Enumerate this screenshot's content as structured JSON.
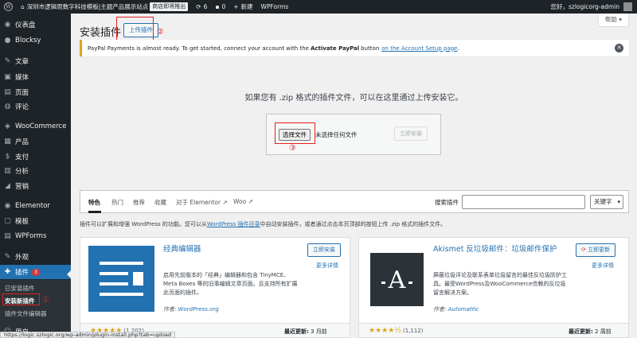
{
  "admin_bar": {
    "site_name": "深圳市逻辑思数字科技模板|主题产品展示站点",
    "badge": "商店即将推出",
    "updates": "6",
    "comments": "0",
    "new": "新建",
    "wpforms": "WPForms",
    "greeting": "您好，szlogicorg-admin"
  },
  "sidebar": {
    "items": [
      {
        "label": "仪表盘",
        "icon": "dashboard-icon",
        "glyph": "◉"
      },
      {
        "label": "Blocksy",
        "icon": "blocksy-icon",
        "glyph": "●"
      },
      {
        "label": "文章",
        "icon": "pin-icon",
        "glyph": "✎"
      },
      {
        "label": "媒体",
        "icon": "media-icon",
        "glyph": "▣"
      },
      {
        "label": "页面",
        "icon": "page-icon",
        "glyph": "▤"
      },
      {
        "label": "评论",
        "icon": "comment-icon",
        "glyph": "◍"
      },
      {
        "label": "WooCommerce",
        "icon": "woocommerce-icon",
        "glyph": "◈"
      },
      {
        "label": "产品",
        "icon": "product-icon",
        "glyph": "▦"
      },
      {
        "label": "支付",
        "icon": "payment-icon",
        "glyph": "$"
      },
      {
        "label": "分析",
        "icon": "analytics-icon",
        "glyph": "▥"
      },
      {
        "label": "营销",
        "icon": "marketing-icon",
        "glyph": "◢"
      },
      {
        "label": "Elementor",
        "icon": "elementor-icon",
        "glyph": "◉"
      },
      {
        "label": "模板",
        "icon": "template-icon",
        "glyph": "▢"
      },
      {
        "label": "WPForms",
        "icon": "wpforms-icon",
        "glyph": "▤"
      },
      {
        "label": "外观",
        "icon": "appearance-icon",
        "glyph": "✎"
      },
      {
        "label": "插件",
        "icon": "plugin-icon",
        "glyph": "✚",
        "badge": "3"
      }
    ],
    "submenu": [
      "已安装插件",
      "安装新插件",
      "插件文件编辑器"
    ],
    "users": "用户"
  },
  "header": {
    "title": "安装插件",
    "upload_button": "上传插件",
    "help": "帮助 ▾"
  },
  "annotations": [
    "②",
    "①",
    "③"
  ],
  "notice": {
    "text_before": "PayPal Payments is almost ready. To get started, connect your account with the",
    "bold": "Activate PayPal",
    "text_mid": "button",
    "link": "on the Account Setup page",
    "text_after": "."
  },
  "upload": {
    "description": "如果您有 .zip 格式的插件文件，可以在这里通过上传安装它。",
    "choose_button": "选择文件",
    "no_file": "未选择任何文件",
    "install_button": "立即安装"
  },
  "filters": {
    "tabs": [
      "特色",
      "热门",
      "推荐",
      "收藏",
      "对于 Elementor ↗",
      "Woo ↗"
    ],
    "search_label": "搜索插件",
    "search_placeholder": "",
    "select_value": "关键字"
  },
  "intro": {
    "before": "插件可以扩展和增强 WordPress 的功能。您可以从",
    "link": "WordPress 插件目录",
    "after": "中自动安装插件，或者通过点击本页顶部的按钮上传 .zip 格式的插件文件。"
  },
  "plugins": [
    {
      "name": "经典编辑器",
      "description": "启用先前版本的「经典」编辑器和包含 TinyMCE、Meta Boxes 等的旧事编辑文章页面。且支持所有扩展此页面的插件。",
      "author_label": "作者:",
      "author": "WordPress.org",
      "button": "立即安装",
      "more": "更多详情",
      "rating": 5,
      "stars": "★★★★★",
      "rating_count": "(1,202)",
      "updated_label": "最近更新:",
      "updated_value": "3 月前"
    },
    {
      "name": "Akismet 反垃圾邮件：垃圾邮件保护",
      "description": "屏蔽垃圾评论及联系表单垃圾留言的最佳反垃圾防护工具。最受WordPress及WooCommerce信赖的反垃圾留言解决方案。",
      "author_label": "作者:",
      "author": "Automattic",
      "button": "立即更新",
      "more": "更多详情",
      "rating": 4.5,
      "stars": "★★★★½",
      "rating_count": "(1,112)",
      "updated_label": "最近更新:",
      "updated_value": "2 周前"
    }
  ],
  "status_bar": "https://logic.szlogic.org/wp-admin/plugin-install.php?tab=upload",
  "colors": {
    "accent": "#2271b1",
    "admin_bar": "#1d2327",
    "warning": "#dba617",
    "annotation": "#e02020"
  }
}
